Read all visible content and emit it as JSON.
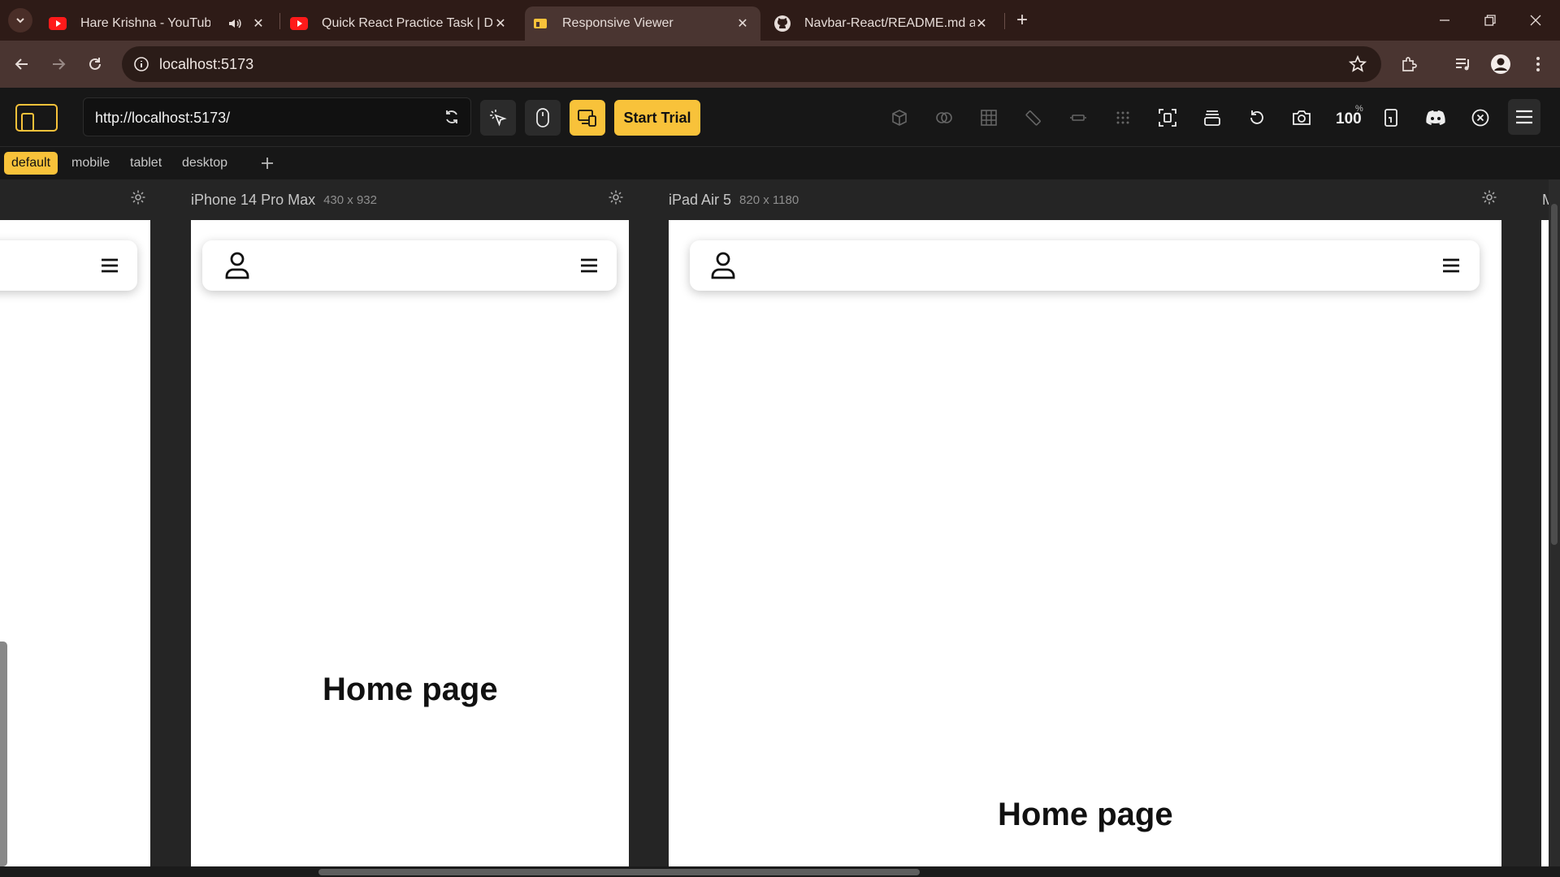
{
  "browser": {
    "tabs": [
      {
        "title": "Hare Krishna - YouTube",
        "icon": "youtube-icon",
        "audio": true
      },
      {
        "title": "Quick React Practice Task | Docs",
        "icon": "youtube-icon"
      },
      {
        "title": "Responsive Viewer",
        "icon": "responsive-viewer-icon",
        "active": true
      },
      {
        "title": "Navbar-React/README.md at main",
        "icon": "github-icon"
      }
    ],
    "address": "localhost:5173"
  },
  "viewer": {
    "url": "http://localhost:5173/",
    "start_trial": "Start Trial",
    "zoom": "100",
    "zoom_unit": "%",
    "presets": [
      "default",
      "mobile",
      "tablet",
      "desktop"
    ],
    "active_preset": "default",
    "devices": [
      {
        "name": "iPhone 14 Pro Max",
        "size": "430 x 932"
      },
      {
        "name": "iPad Air 5",
        "size": "820 x 1180"
      },
      {
        "name": "M"
      }
    ],
    "page_text": "Home page",
    "accent": "#f8c23a"
  }
}
